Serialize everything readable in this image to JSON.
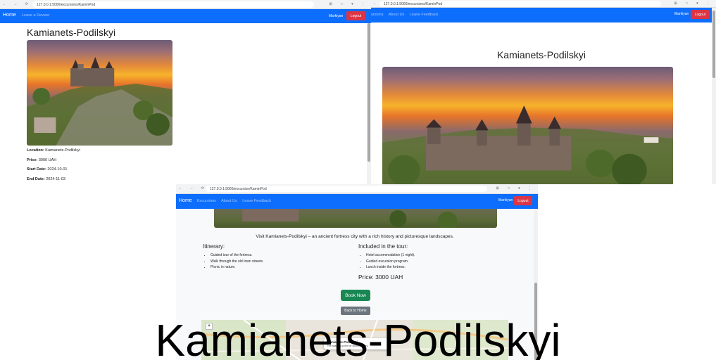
{
  "window1": {
    "url": "127.0.0.1:5000/excursions/KaminPod",
    "nav": {
      "brand": "Home",
      "links": [
        "Leave a Review"
      ],
      "user": "Markiyan",
      "logout": "Logout"
    },
    "title": "Kamianets-Podilskyi",
    "details": [
      {
        "label": "Location:",
        "value": "Kamianets-Podilskyi"
      },
      {
        "label": "Price:",
        "value": "3000 UAH"
      },
      {
        "label": "Start Date:",
        "value": "2024-10-01"
      },
      {
        "label": "End Date:",
        "value": "2024-11-03"
      }
    ]
  },
  "window2": {
    "url": "127.0.0.1:5000/excursions/KaminPod",
    "nav": {
      "links": [
        "cursions",
        "About Us",
        "Leave Feedback"
      ],
      "user": "Markiyan",
      "logout": "Logout"
    },
    "title": "Kamianets-Podilskyi"
  },
  "window3": {
    "url": "127.0.0.1:5000/excursion/KaminPod",
    "nav": {
      "brand": "Home",
      "links": [
        "Excursions",
        "About Us",
        "Leave Feedback"
      ],
      "user": "Markiyan",
      "logout": "Logout"
    },
    "description": "Visit Kamianets-Podilskyi – an ancient fortress city with a rich history and picturesque landscapes.",
    "itinerary": {
      "title": "Itinerary:",
      "items": [
        "Guided tour of the fortress.",
        "Walk through the old town streets.",
        "Picnic in nature."
      ]
    },
    "included": {
      "title": "Included in the tour:",
      "items": [
        "Hotel accommodation (1 night).",
        "Guided excursion program.",
        "Lunch inside the fortress."
      ]
    },
    "price": "Price: 3000 UAH",
    "book_button": "Book Now",
    "back_button": "Back to Home",
    "map": {
      "zoom_in": "+",
      "popup_title": "Kamianets-Podilskyi",
      "popup_text": "The starting point of your journey"
    }
  },
  "caption": "Kamianets-Podilskyi",
  "colors": {
    "navbar": "#0d6efd",
    "logout": "#dc3545",
    "book": "#198754",
    "back": "#6c757d"
  }
}
